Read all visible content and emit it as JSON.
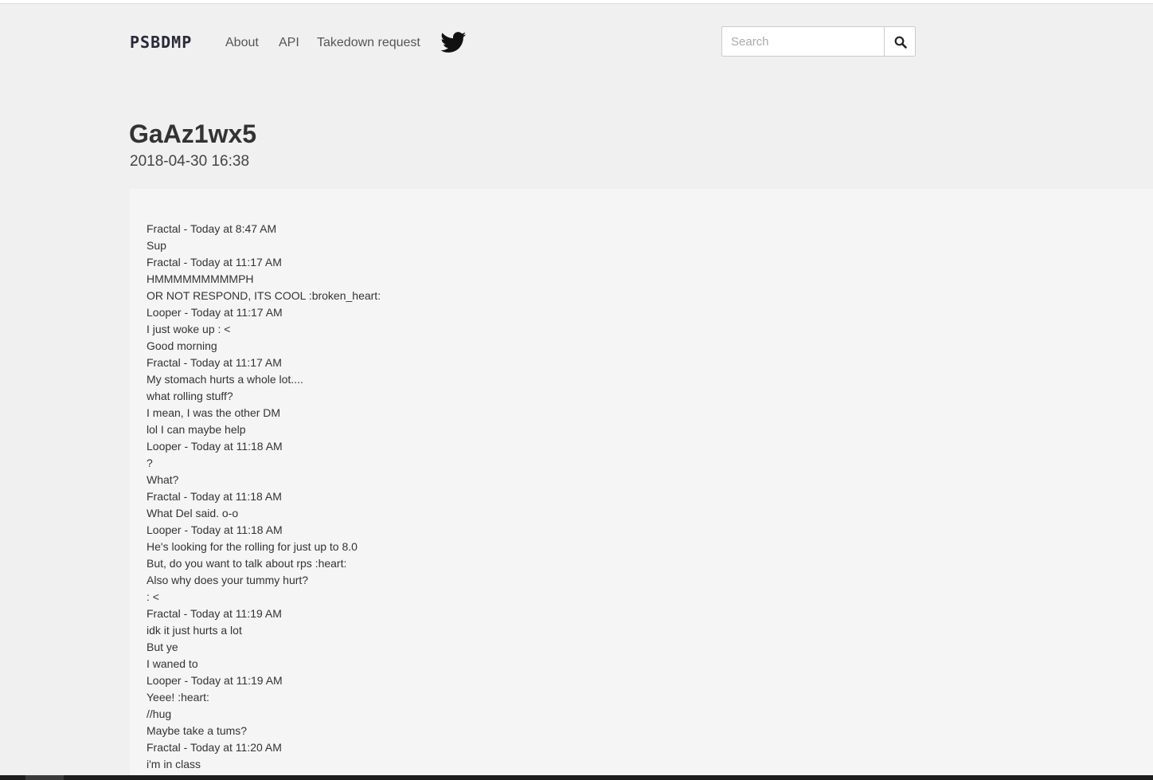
{
  "nav": {
    "logo": "PSBDMP",
    "links": [
      "About",
      "API",
      "Takedown request"
    ],
    "twitter_icon": "twitter-bird-icon",
    "search_placeholder": "Search",
    "search_icon": "magnifier-icon"
  },
  "paste": {
    "title": "GaAz1wx5",
    "date": "2018-04-30 16:38",
    "lines": [
      "Fractal - Today at 8:47 AM",
      "Sup",
      "Fractal - Today at 11:17 AM",
      "HMMMMMMMMMPH",
      "OR NOT RESPOND, ITS COOL :broken_heart:",
      "Looper - Today at 11:17 AM",
      "I just woke up : <",
      "Good morning",
      "Fractal - Today at 11:17 AM",
      "My stomach hurts a whole lot....",
      "what rolling stuff?",
      "I mean, I was the other DM",
      "lol I can maybe help",
      "Looper - Today at 11:18 AM",
      "?",
      "What?",
      "Fractal - Today at 11:18 AM",
      "What Del said. o-o",
      "Looper - Today at 11:18 AM",
      "He's looking for the rolling for just up to 8.0",
      "But, do you want to talk about rps :heart:",
      "Also why does your tummy hurt?",
      ": <",
      "Fractal - Today at 11:19 AM",
      "idk it just hurts a lot",
      "But ye",
      "I waned to",
      "Looper - Today at 11:19 AM",
      "Yeee! :heart:",
      "//hug",
      "Maybe take a tums?",
      "Fractal - Today at 11:20 AM",
      "i'm in class"
    ]
  }
}
